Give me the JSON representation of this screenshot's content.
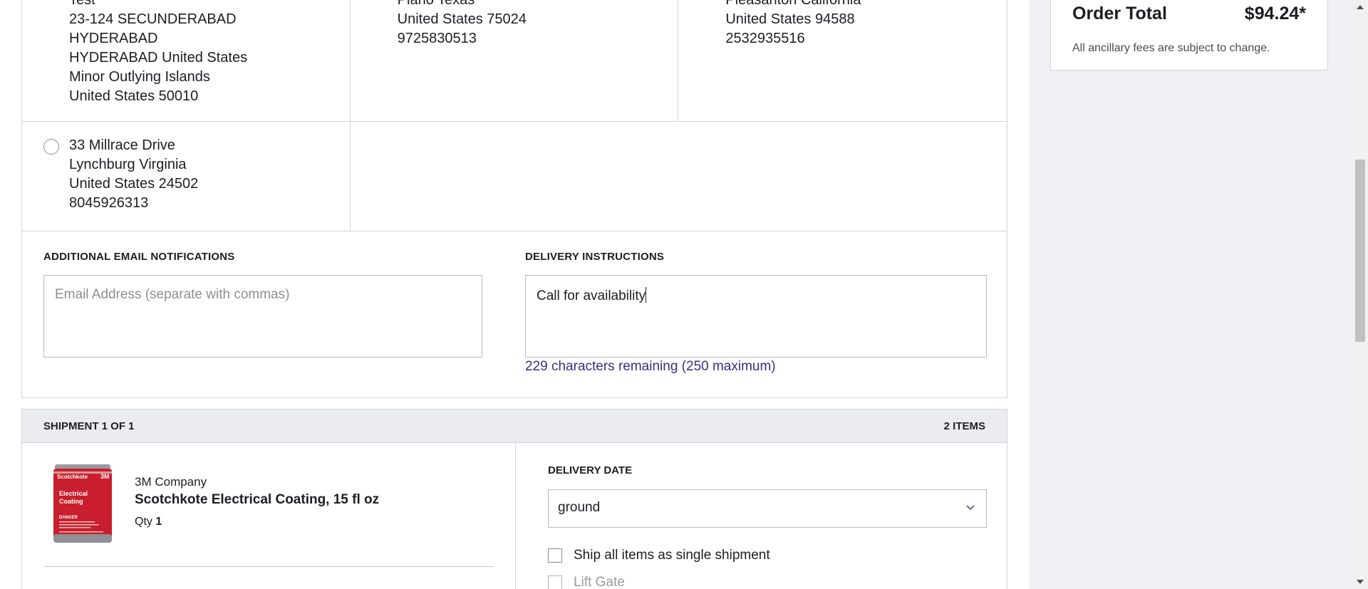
{
  "addresses": {
    "row1": [
      {
        "lines": [
          "Test",
          "23-124 SECUNDERABAD",
          "HYDERABAD",
          "HYDERABAD United States",
          "Minor Outlying Islands",
          "United States 50010"
        ]
      },
      {
        "lines": [
          "Plano Texas",
          "United States 75024",
          "9725830513"
        ]
      },
      {
        "lines": [
          "Pleasanton California",
          "United States 94588",
          "2532935516"
        ]
      }
    ],
    "row2": [
      {
        "lines": [
          "33 Millrace Drive",
          "Lynchburg Virginia",
          "United States 24502",
          "8045926313"
        ]
      }
    ]
  },
  "notifications": {
    "label": "ADDITIONAL EMAIL NOTIFICATIONS",
    "placeholder": "Email Address (separate with commas)"
  },
  "delivery_instructions": {
    "label": "DELIVERY INSTRUCTIONS",
    "value": "Call for availability",
    "counter": "229 characters remaining (250 maximum)"
  },
  "shipment": {
    "title": "SHIPMENT 1 OF 1",
    "items_count": "2 ITEMS",
    "item": {
      "brand": "3M Company",
      "name": "Scotchkote Electrical Coating, 15 fl oz",
      "qty_label": "Qty",
      "qty": "1",
      "image_text": {
        "brand": "Scotchkote",
        "logo": "3M",
        "line1": "Electrical",
        "line2": "Coating",
        "danger": "DANGER"
      }
    },
    "delivery_date_label": "DELIVERY DATE",
    "delivery_option": "ground",
    "options": [
      {
        "label": "Ship all items as single shipment",
        "checked": false,
        "disabled": false
      },
      {
        "label": "Lift Gate",
        "checked": false,
        "disabled": true
      }
    ]
  },
  "order_summary": {
    "total_label": "Order Total",
    "total_value": "$94.24*",
    "note": "All ancillary fees are subject to change."
  }
}
